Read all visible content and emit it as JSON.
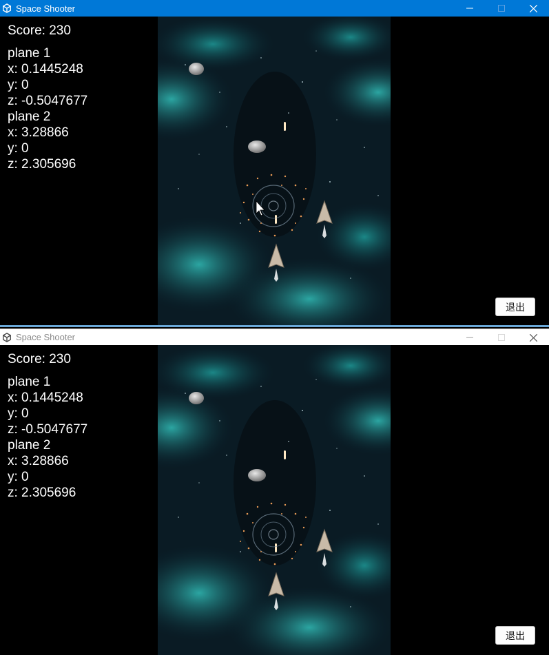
{
  "windows": [
    {
      "title": "Space Shooter",
      "active": true,
      "score_label": "Score: 230",
      "info_lines": [
        "plane 1",
        "x: 0.1445248",
        "y: 0",
        "z: -0.5047677",
        "plane 2",
        "x: 3.28866",
        "y: 0",
        "z: 2.305696"
      ],
      "exit_label": "退出"
    },
    {
      "title": "Space Shooter",
      "active": false,
      "score_label": "Score: 230",
      "info_lines": [
        "plane 1",
        "x: 0.1445248",
        "y: 0",
        "z: -0.5047677",
        "plane 2",
        "x: 3.28866",
        "y: 0",
        "z: 2.305696"
      ],
      "exit_label": "退出"
    }
  ],
  "icons": {
    "app": "unity-logo-icon",
    "minimize": "minimize-icon",
    "maximize": "maximize-icon",
    "close": "close-icon"
  },
  "colors": {
    "titlebar_active": "#0078d7",
    "titlebar_inactive": "#ffffff",
    "nebula": "#1b8a8a",
    "space": "#0a1e28"
  }
}
